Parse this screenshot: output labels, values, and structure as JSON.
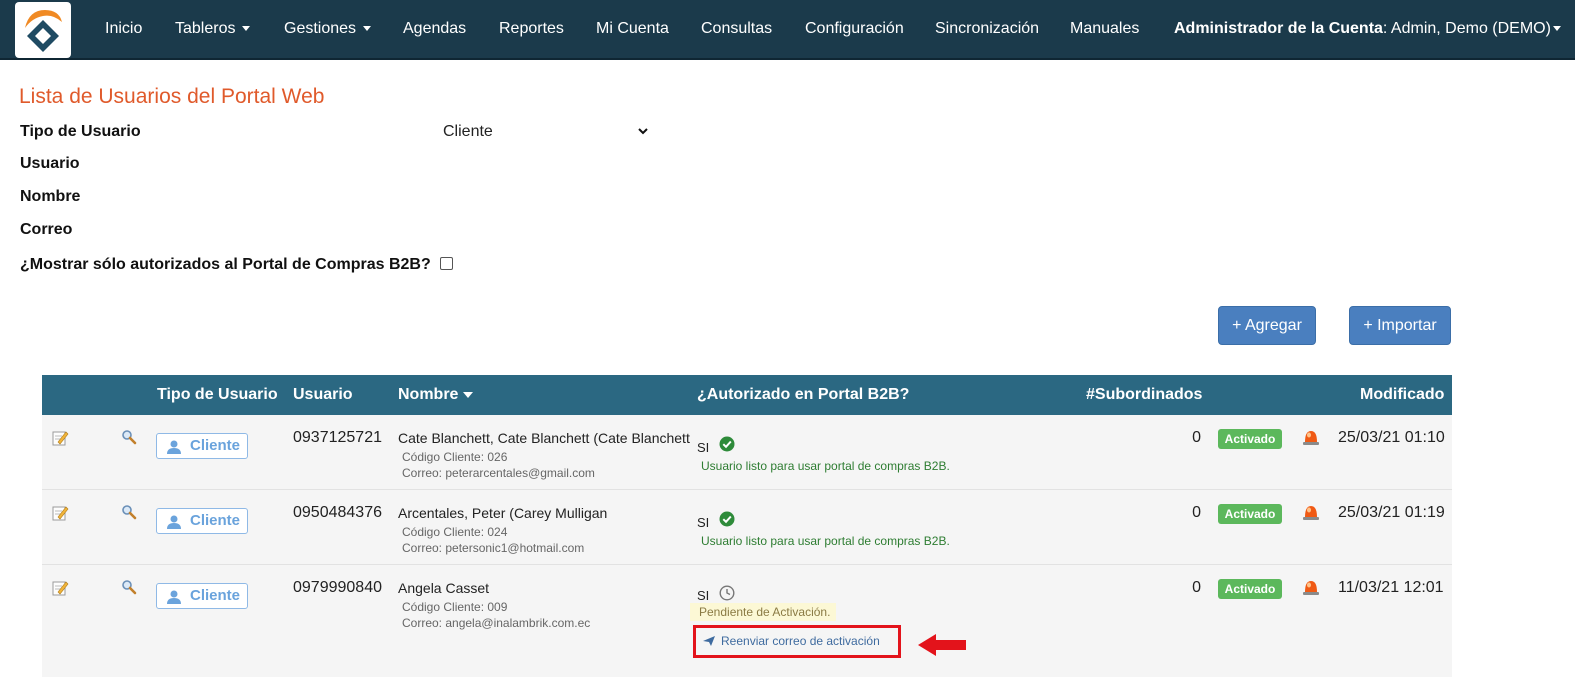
{
  "navbar": {
    "items": [
      {
        "label": "Inicio",
        "has_caret": false
      },
      {
        "label": "Tableros",
        "has_caret": true
      },
      {
        "label": "Gestiones",
        "has_caret": true
      },
      {
        "label": "Agendas",
        "has_caret": false
      },
      {
        "label": "Reportes",
        "has_caret": false
      },
      {
        "label": "Mi Cuenta",
        "has_caret": false
      },
      {
        "label": "Consultas",
        "has_caret": false
      },
      {
        "label": "Configuración",
        "has_caret": false
      },
      {
        "label": "Sincronización",
        "has_caret": false
      },
      {
        "label": "Manuales",
        "has_caret": false
      }
    ],
    "account_role": "Administrador de la Cuenta",
    "account_name": ": Admin, Demo (DEMO)",
    "colors": {
      "background": "#1b3a4b",
      "text": "#ffffff"
    }
  },
  "page": {
    "title": "Lista de Usuarios del Portal Web",
    "title_color": "#e05a2b"
  },
  "filters": {
    "tipo_usuario_label": "Tipo de Usuario",
    "tipo_usuario_value": "Cliente",
    "usuario_label": "Usuario",
    "nombre_label": "Nombre",
    "correo_label": "Correo",
    "b2b_only_label": "¿Mostrar sólo autorizados al Portal de Compras B2B?",
    "b2b_only_checked": false
  },
  "actions": {
    "add_label": "+ Agregar",
    "import_label": "+ Importar",
    "button_color": "#4a7fbf"
  },
  "table": {
    "header_color": "#2b6882",
    "columns": {
      "tipo_usuario": "Tipo de Usuario",
      "usuario": "Usuario",
      "nombre": "Nombre",
      "autorizado": "¿Autorizado en Portal B2B?",
      "subordinados": "#Subordinados",
      "modificado": "Modificado"
    },
    "rows": [
      {
        "tipo": "Cliente",
        "usuario": "0937125721",
        "nombre": "Cate Blanchett, Cate Blanchett (Cate Blanchett",
        "codigo": "Código Cliente: 026",
        "correo": "Correo: peterarcentales@gmail.com",
        "autorizado": "SI",
        "auth_status": "ready",
        "auth_message": "Usuario listo para usar portal de compras B2B.",
        "subordinados": "0",
        "estado": "Activado",
        "modificado": "25/03/21 01:10"
      },
      {
        "tipo": "Cliente",
        "usuario": "0950484376",
        "nombre": "Arcentales, Peter (Carey Mulligan",
        "codigo": "Código Cliente: 024",
        "correo": "Correo: petersonic1@hotmail.com",
        "autorizado": "SI",
        "auth_status": "ready",
        "auth_message": "Usuario listo para usar portal de compras B2B.",
        "subordinados": "0",
        "estado": "Activado",
        "modificado": "25/03/21 01:19"
      },
      {
        "tipo": "Cliente",
        "usuario": "0979990840",
        "nombre": "Angela Casset",
        "codigo": "Código Cliente: 009",
        "correo": "Correo: angela@inalambrik.com.ec",
        "autorizado": "SI",
        "auth_status": "pending",
        "auth_message": "Pendiente de Activación.",
        "resend_label": "Reenviar correo de activación",
        "subordinados": "0",
        "estado": "Activado",
        "modificado": "11/03/21 12:01"
      }
    ]
  },
  "icons": {
    "edit": "edit-icon",
    "view": "magnifier-icon",
    "user": "user-icon",
    "ready": "check-circle-icon",
    "pending": "clock-icon",
    "resend": "send-icon",
    "alarm": "alarm-light-icon",
    "annotation": "red-arrow-icon"
  }
}
